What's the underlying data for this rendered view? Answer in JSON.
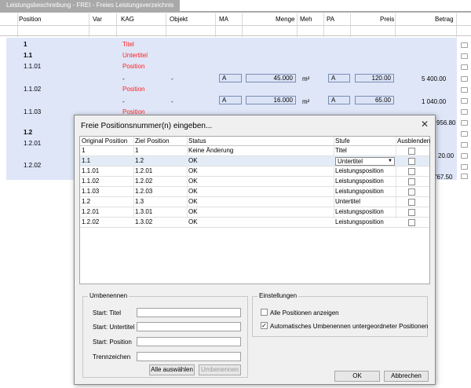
{
  "tab": {
    "title": "Leistungsbeschreibung - FREI - Freies Leistungsverzeichnis"
  },
  "columns": {
    "position": "Position",
    "var": "Var",
    "kag": "KAG",
    "objekt": "Objekt",
    "ma": "MA",
    "menge": "Menge",
    "meh": "Meh",
    "pa": "PA",
    "preis": "Preis",
    "betrag": "Betrag"
  },
  "rows": [
    {
      "pos": "1",
      "kag": "Titel"
    },
    {
      "pos": "1.1",
      "kag": "Untertitel"
    },
    {
      "pos": "1.1.01",
      "kag": "Position",
      "kag_dash": "-",
      "obj_dash": "-",
      "ma": "A",
      "menge": "45.000",
      "meh": "m²",
      "pa": "A",
      "preis": "120.00",
      "betrag": "5 400.00"
    },
    {
      "pos": "1.1.02",
      "kag": "Position",
      "kag_dash": "-",
      "obj_dash": "-",
      "ma": "A",
      "menge": "16.000",
      "meh": "m²",
      "pa": "A",
      "preis": "65.00",
      "betrag": "1 040.00"
    },
    {
      "pos": "1.1.03",
      "kag": "Position",
      "betrag_partial": "956.80"
    },
    {
      "pos": "1.2"
    },
    {
      "pos": "1.2.01",
      "betrag_partial": "20.00"
    },
    {
      "pos": "1.2.02",
      "betrag_partial": "767.50"
    }
  ],
  "dialog": {
    "title": "Freie Positionsnummer(n) eingeben...",
    "grid_headers": {
      "orig": "Original Position",
      "ziel": "Ziel Position",
      "status": "Status",
      "stufe": "Stufe",
      "ausblenden": "Ausblenden"
    },
    "grid_rows": [
      {
        "orig": "1",
        "ziel": "1",
        "status": "Keine Änderung",
        "stufe": "Titel"
      },
      {
        "orig": "1.1",
        "ziel": "1.2",
        "status": "OK",
        "stufe": "Untertitel"
      },
      {
        "orig": "1.1.01",
        "ziel": "1.2.01",
        "status": "OK",
        "stufe": "Leistungsposition"
      },
      {
        "orig": "1.1.02",
        "ziel": "1.2.02",
        "status": "OK",
        "stufe": "Leistungsposition"
      },
      {
        "orig": "1.1.03",
        "ziel": "1.2.03",
        "status": "OK",
        "stufe": "Leistungsposition"
      },
      {
        "orig": "1.2",
        "ziel": "1.3",
        "status": "OK",
        "stufe": "Untertitel"
      },
      {
        "orig": "1.2.01",
        "ziel": "1.3.01",
        "status": "OK",
        "stufe": "Leistungsposition"
      },
      {
        "orig": "1.2.02",
        "ziel": "1.3.02",
        "status": "OK",
        "stufe": "Leistungsposition"
      }
    ],
    "umbenennen": {
      "group": "Umbenennen",
      "start_titel": "Start: Titel",
      "start_untertitel": "Start: Untertitel",
      "start_position": "Start: Position",
      "trennzeichen": "Trennzeichen",
      "alle_auswaehlen": "Alle auswählen",
      "umbenennen_btn": "Umbenennen"
    },
    "einstellungen": {
      "group": "Einstellungen",
      "alle_positionen": "Alle Positionen anzeigen",
      "alle_positionen_checked": false,
      "auto_umbenennen": "Automatisches Umbenennen untergeordneter Positionen",
      "auto_umbenennen_checked": true
    },
    "ok": "OK",
    "abbrechen": "Abbrechen"
  },
  "colors": {
    "tab": "#a9a9a9",
    "row_bg": "#dfe6f8",
    "red_text": "#ff2222",
    "dialog_bg": "#f0f0f0",
    "selected_row": "#e3ecf6"
  }
}
